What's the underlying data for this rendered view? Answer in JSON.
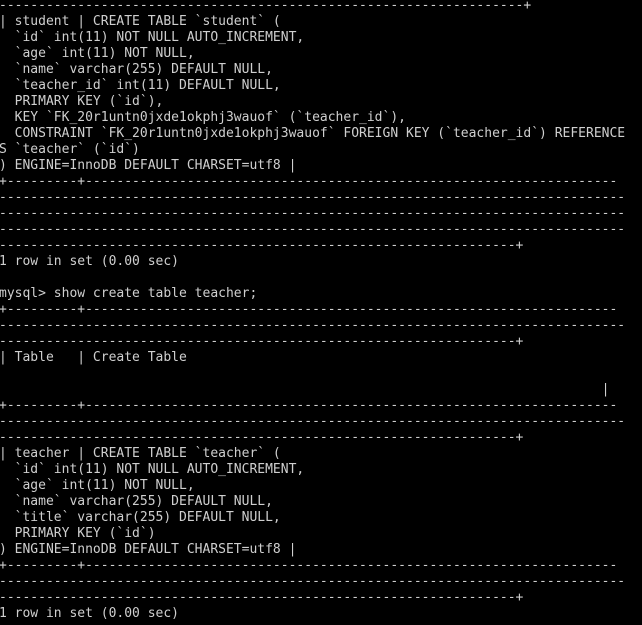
{
  "terminal": {
    "app": "mysql-client-terminal",
    "columns": 80,
    "rows": 39,
    "background_color": "#000000",
    "foreground_color": "#cccccc",
    "cursor_visible": false,
    "prompt": "mysql>"
  },
  "commands": [
    {
      "name": "show-create-table-teacher",
      "text": "mysql> show create table teacher;"
    }
  ],
  "results": [
    {
      "name": "student-result-status",
      "text": "1 row in set (0.00 sec)"
    },
    {
      "name": "teacher-result-status",
      "text": "1 row in set (0.00 sec)"
    }
  ],
  "tables": {
    "student": {
      "name": "student",
      "create_statement_lines": [
        "| student | CREATE TABLE `student` (",
        "  `id` int(11) NOT NULL AUTO_INCREMENT,",
        "  `age` int(11) NOT NULL,",
        "  `name` varchar(255) DEFAULT NULL,",
        "  `teacher_id` int(11) DEFAULT NULL,",
        "  PRIMARY KEY (`id`),",
        "  KEY `FK_20r1untn0jxde1okphj3wauof` (`teacher_id`),",
        "  CONSTRAINT `FK_20r1untn0jxde1okphj3wauof` FOREIGN KEY (`teacher_id`) REFERENCE",
        "S `teacher` (`id`)",
        ") ENGINE=InnoDB DEFAULT CHARSET=utf8 |"
      ]
    },
    "teacher": {
      "name": "teacher",
      "headers": "| Table   | Create Table",
      "create_statement_lines": [
        "| teacher | CREATE TABLE `teacher` (",
        "  `id` int(11) NOT NULL AUTO_INCREMENT,",
        "  `age` int(11) NOT NULL,",
        "  `name` varchar(255) DEFAULT NULL,",
        "  `title` varchar(255) DEFAULT NULL,",
        "  PRIMARY KEY (`id`)",
        ") ENGINE=InnoDB DEFAULT CHARSET=utf8 |"
      ]
    }
  },
  "screen_lines": [
    "-------------------------------------------------------------------+",
    "| student | CREATE TABLE `student` (",
    "  `id` int(11) NOT NULL AUTO_INCREMENT,",
    "  `age` int(11) NOT NULL,",
    "  `name` varchar(255) DEFAULT NULL,",
    "  `teacher_id` int(11) DEFAULT NULL,",
    "  PRIMARY KEY (`id`),",
    "  KEY `FK_20r1untn0jxde1okphj3wauof` (`teacher_id`),",
    "  CONSTRAINT `FK_20r1untn0jxde1okphj3wauof` FOREIGN KEY (`teacher_id`) REFERENCE",
    "S `teacher` (`id`)",
    ") ENGINE=InnoDB DEFAULT CHARSET=utf8 |",
    "+---------+--------------------------------------------------------------------",
    "--------------------------------------------------------------------------------",
    "--------------------------------------------------------------------------------",
    "--------------------------------------------------------------------------------",
    "------------------------------------------------------------------+",
    "1 row in set (0.00 sec)",
    "",
    "mysql> show create table teacher;",
    "+---------+--------------------------------------------------------------------",
    "--------------------------------------------------------------------------------",
    "------------------------------------------------------------------+",
    "| Table   | Create Table",
    "",
    "                                                                             |",
    "+---------+--------------------------------------------------------------------",
    "--------------------------------------------------------------------------------",
    "------------------------------------------------------------------+",
    "| teacher | CREATE TABLE `teacher` (",
    "  `id` int(11) NOT NULL AUTO_INCREMENT,",
    "  `age` int(11) NOT NULL,",
    "  `name` varchar(255) DEFAULT NULL,",
    "  `title` varchar(255) DEFAULT NULL,",
    "  PRIMARY KEY (`id`)",
    ") ENGINE=InnoDB DEFAULT CHARSET=utf8 |",
    "+---------+--------------------------------------------------------------------",
    "--------------------------------------------------------------------------------",
    "------------------------------------------------------------------+",
    "1 row in set (0.00 sec)"
  ]
}
